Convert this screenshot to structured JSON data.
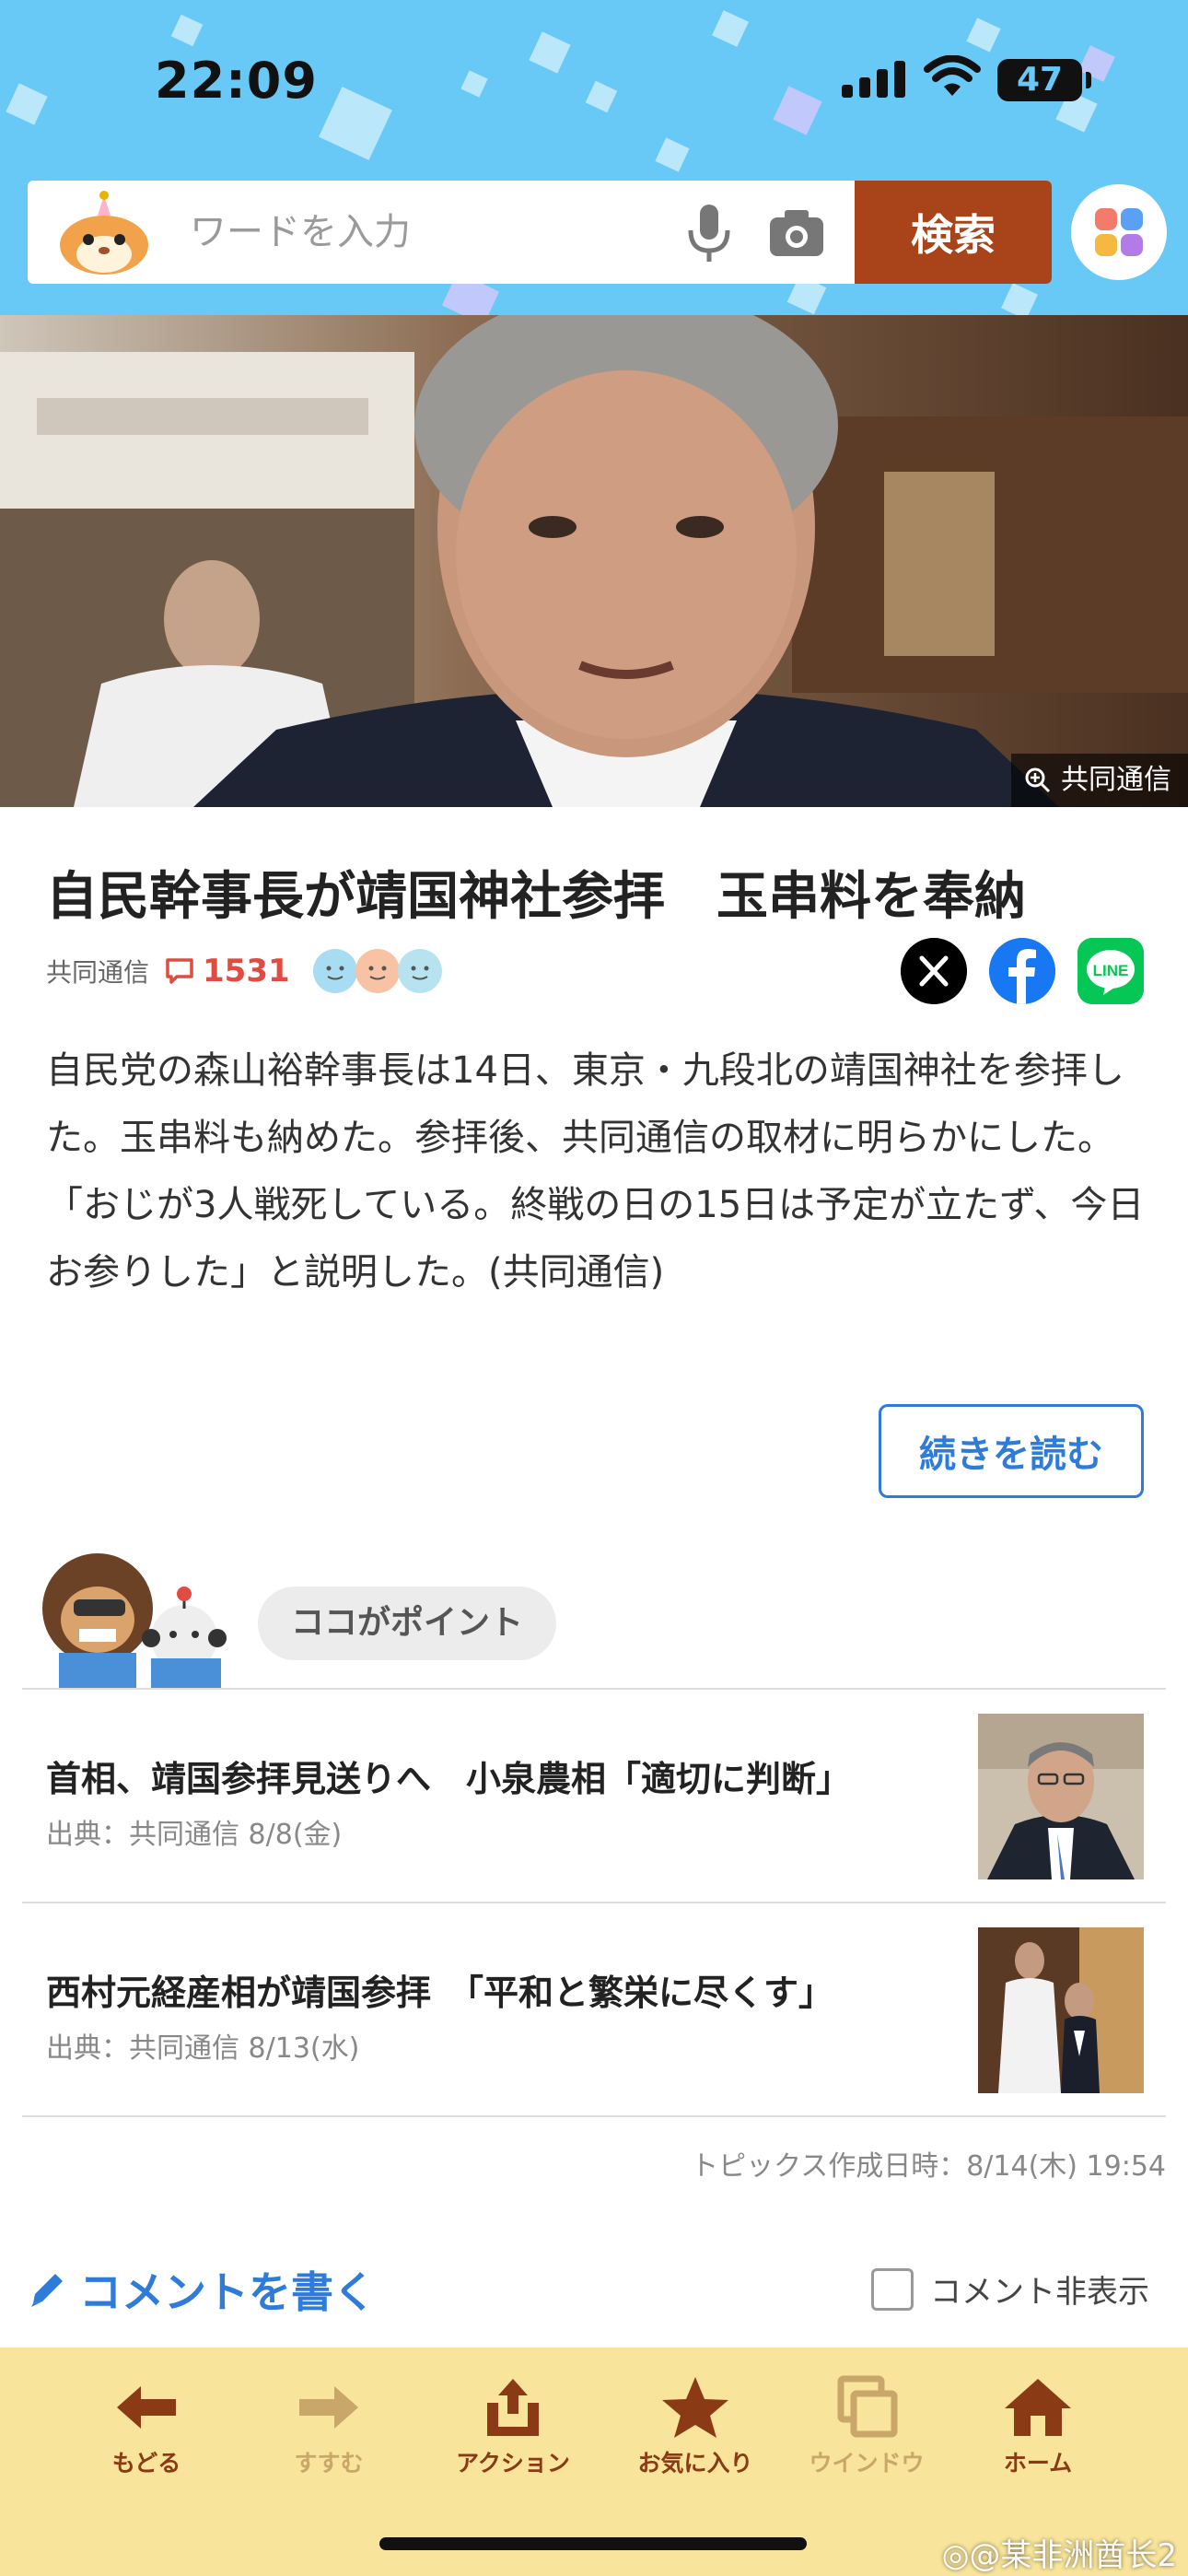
{
  "status_bar": {
    "time": "22:09",
    "battery": "47"
  },
  "search": {
    "placeholder": "ワードを入力",
    "button_label": "検索"
  },
  "hero": {
    "credit": "共同通信"
  },
  "article": {
    "title": "自民幹事長が靖国神社参拝　玉串料を奉納",
    "source": "共同通信",
    "comment_count": "1531",
    "body": "自民党の森山裕幹事長は14日、東京・九段北の靖国神社を参拝した。玉串料も納めた。参拝後、共同通信の取材に明らかにした。「おじが3人戦死している。終戦の日の15日は予定が立たず、今日お参りした」と説明した。(共同通信)",
    "read_more": "続きを読む"
  },
  "point": {
    "label": "ココがポイント",
    "topics": [
      {
        "title": "首相、靖国参拝見送りへ　小泉農相「適切に判断」",
        "source": "出典：共同通信 8/8(金)"
      },
      {
        "title": "西村元経産相が靖国参拝　「平和と繁栄に尽くす」",
        "source": "出典：共同通信 8/13(水)"
      }
    ],
    "created": "トピックス作成日時：8/14(木) 19:54"
  },
  "comments": {
    "write_label": "コメントを書く",
    "hide_label": "コメント非表示"
  },
  "toolbar": {
    "items": [
      {
        "label": "もどる",
        "icon": "back-arrow-icon"
      },
      {
        "label": "すすむ",
        "icon": "forward-arrow-icon"
      },
      {
        "label": "アクション",
        "icon": "share-icon"
      },
      {
        "label": "お気に入り",
        "icon": "star-icon"
      },
      {
        "label": "ウインドウ",
        "icon": "window-icon"
      },
      {
        "label": "ホーム",
        "icon": "home-icon"
      }
    ]
  },
  "watermark": "◎@某非洲酋长2",
  "colors": {
    "header_bg": "#69c9f6",
    "search_button": "#a8431a",
    "comment_red": "#e04b42",
    "link_blue": "#2f7bd9",
    "toolbar_bg": "#f8e49a",
    "toolbar_icon": "#8a3a14",
    "toolbar_icon_disabled": "#c9a66a"
  }
}
